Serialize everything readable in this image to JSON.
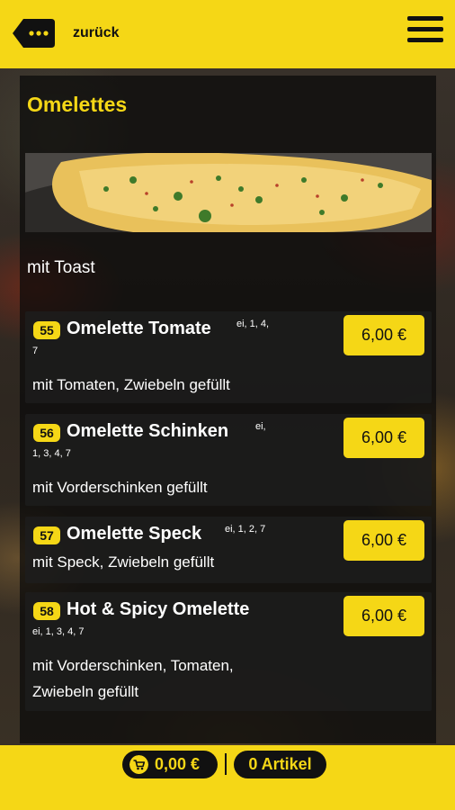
{
  "header": {
    "back_label": "zurück",
    "back_icon": "back-arrow-dots-icon",
    "menu_icon": "hamburger-menu-icon"
  },
  "section": {
    "title": "Omelettes",
    "subtitle": "mit Toast"
  },
  "items": [
    {
      "number": "55",
      "name": "Omelette Tomate",
      "allergens_line1": "ei, 1, 4,",
      "allergens_line2": "7",
      "description": "mit Tomaten, Zwiebeln gefüllt",
      "price": "6,00 €"
    },
    {
      "number": "56",
      "name": "Omelette Schinken",
      "allergens_line1": "ei,",
      "allergens_line2": "1, 3, 4, 7",
      "description": "mit Vorderschinken gefüllt",
      "price": "6,00 €"
    },
    {
      "number": "57",
      "name": "Omelette Speck",
      "allergens_line1": "ei, 1, 2, 7",
      "allergens_line2": "",
      "description": "mit Speck, Zwiebeln gefüllt",
      "price": "6,00 €"
    },
    {
      "number": "58",
      "name": "Hot & Spicy Omelette",
      "allergens_line1": "",
      "allergens_line2": "ei, 1, 3, 4, 7",
      "description_line1": "mit Vorderschinken, Tomaten,",
      "description_line2": "Zwiebeln gefüllt",
      "price": "6,00 €"
    }
  ],
  "footer": {
    "cart_icon": "shopping-cart-icon",
    "cart_total": "0,00 €",
    "items_count": "0 Artikel"
  },
  "colors": {
    "accent": "#f5d716",
    "panel": "#0a0a0a"
  }
}
